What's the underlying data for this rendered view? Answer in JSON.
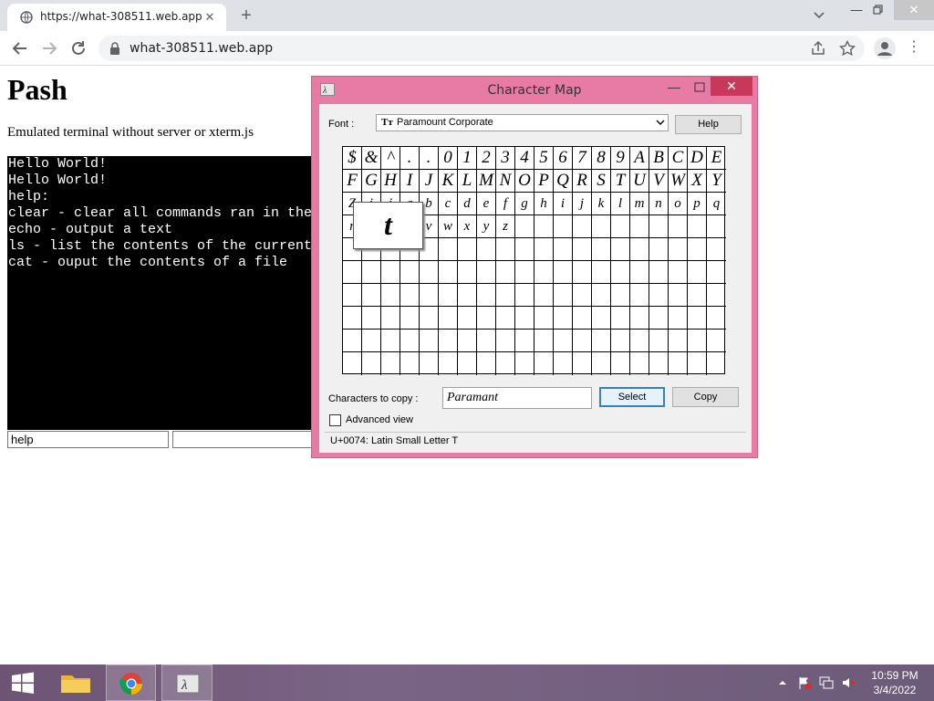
{
  "browser": {
    "tab_title": "https://what-308511.web.app",
    "tab_close": "✕",
    "new_tab": "+",
    "url": "what-308511.web.app",
    "menu": "⋮"
  },
  "page": {
    "title": "Pash",
    "subtitle": "Emulated terminal without server or xterm.js",
    "terminal_lines": [
      "Hello World!",
      "Hello World!",
      "help:",
      "clear - clear all commands ran in the terminal",
      "echo - output a text",
      "ls - list the contents of the current directory",
      "cat - ouput the contents of a file"
    ],
    "command_value": "help"
  },
  "charmap": {
    "title": "Character Map",
    "min": "—",
    "close": "✕",
    "font_label": "Font :",
    "font_value": "Paramount Corporate",
    "font_icon": "Tт",
    "help_button": "Help",
    "rows": [
      [
        "$",
        "&",
        "^",
        ".",
        ".",
        "0",
        "1",
        "2",
        "3",
        "4",
        "5",
        "6",
        "7",
        "8",
        "9",
        "A",
        "B",
        "C",
        "D",
        "E"
      ],
      [
        "F",
        "G",
        "H",
        "I",
        "J",
        "K",
        "L",
        "M",
        "N",
        "O",
        "P",
        "Q",
        "R",
        "S",
        "T",
        "U",
        "V",
        "W",
        "X",
        "Y"
      ],
      [
        "Z",
        "i",
        "j",
        "a",
        "b",
        "c",
        "d",
        "e",
        "f",
        "g",
        "h",
        "i",
        "j",
        "k",
        "l",
        "m",
        "n",
        "o",
        "p",
        "q"
      ],
      [
        "r",
        "",
        "",
        "",
        "v",
        "w",
        "x",
        "y",
        "z",
        "",
        "",
        "",
        "",
        "",
        "",
        "",
        "",
        "",
        "",
        ""
      ]
    ],
    "zoom_char": "t",
    "copy_label": "Characters to copy :",
    "copy_value": "Paramant",
    "select_button": "Select",
    "copy_button": "Copy",
    "advanced_label": "Advanced view",
    "status": "U+0074: Latin Small Letter T"
  },
  "taskbar": {
    "time": "10:59 PM",
    "date": "3/4/2022"
  },
  "colors": {
    "window_frame": "#e87ba3",
    "close_button": "#c7385a",
    "taskbar": "#6e5a7a"
  }
}
